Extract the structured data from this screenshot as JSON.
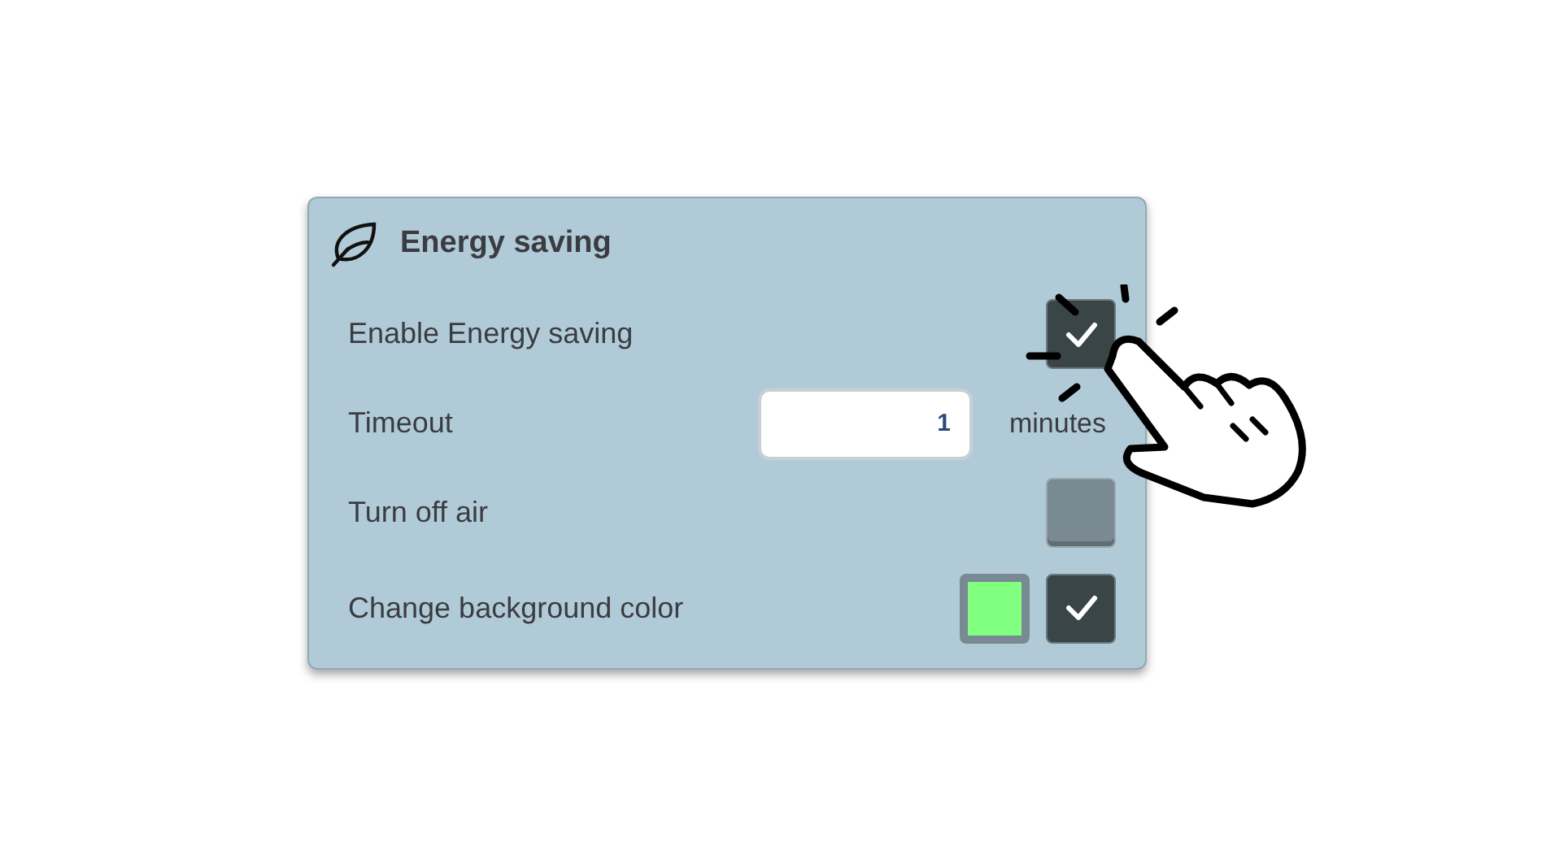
{
  "panel": {
    "title": "Energy saving"
  },
  "rows": [
    {
      "kind": "checkbox",
      "label": "Enable Energy saving",
      "checked": true
    },
    {
      "kind": "number",
      "label": "Timeout",
      "value": "1",
      "unit": "minutes"
    },
    {
      "kind": "checkbox",
      "label": "Turn off air",
      "checked": false
    },
    {
      "kind": "color",
      "label": "Change background color",
      "color": "#80ff80",
      "checked": true
    }
  ]
}
